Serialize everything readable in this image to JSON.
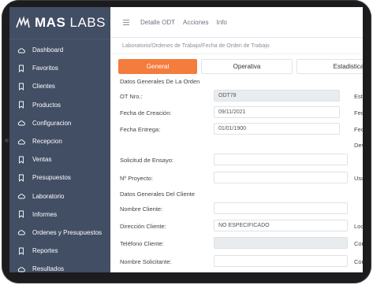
{
  "brand": {
    "bold": "MAS",
    "light": "LABS"
  },
  "sidebar": {
    "items": [
      {
        "label": "Dashboard",
        "icon": "cloud-icon"
      },
      {
        "label": "Favoritos",
        "icon": "bookmark-icon"
      },
      {
        "label": "Clientes",
        "icon": "bookmark-icon"
      },
      {
        "label": "Productos",
        "icon": "bookmark-icon"
      },
      {
        "label": "Configuracion",
        "icon": "cloud-icon"
      },
      {
        "label": "Recepcion",
        "icon": "cloud-icon"
      },
      {
        "label": "Ventas",
        "icon": "bookmark-icon"
      },
      {
        "label": "Presupuestos",
        "icon": "bookmark-icon"
      },
      {
        "label": "Laboratorio",
        "icon": "cloud-icon"
      },
      {
        "label": "Informes",
        "icon": "bookmark-icon"
      },
      {
        "label": "Ordenes y Presupuestos",
        "icon": "cloud-icon"
      },
      {
        "label": "Reportes",
        "icon": "bookmark-icon"
      },
      {
        "label": "Resultados",
        "icon": "cloud-icon"
      }
    ]
  },
  "topbar": {
    "links": [
      "Detalle ODT",
      "Acciones",
      "Info"
    ]
  },
  "breadcrumb": "Laboratorio/Ordenes de Trabajo/Fecha de Orden de Trabajo",
  "tabs": [
    "General",
    "Operativa",
    "Estadistica"
  ],
  "form": {
    "section1": "Datos Generales De La Orden",
    "ot_label": "OT Nro.:",
    "ot_value": "ODT78",
    "creacion_label": "Fecha de Creación:",
    "creacion_value": "09/11/2021",
    "entrega_label": "Fecha Entrega:",
    "entrega_value": "01/01/1900",
    "solicitud_label": "Solicitud de Ensayo:",
    "proyecto_label": "Nº Proyecto:",
    "section2": "Datos Generales Del Cliente",
    "nombre_label": "Nombre Cliente:",
    "direccion_label": "Dirección Cliente:",
    "direccion_value": "NO ESPECIFICADO",
    "telefono_label": "Teléfono Cliente:",
    "solicitante_label": "Nombre Solicitante:"
  },
  "right_labels": [
    "Esta",
    "Fec",
    "Fec",
    "Dev",
    "Usu",
    "Loc",
    "Cor",
    "Cor"
  ],
  "colors": {
    "sidebar": "#414e64",
    "accent": "#f47c3c"
  }
}
